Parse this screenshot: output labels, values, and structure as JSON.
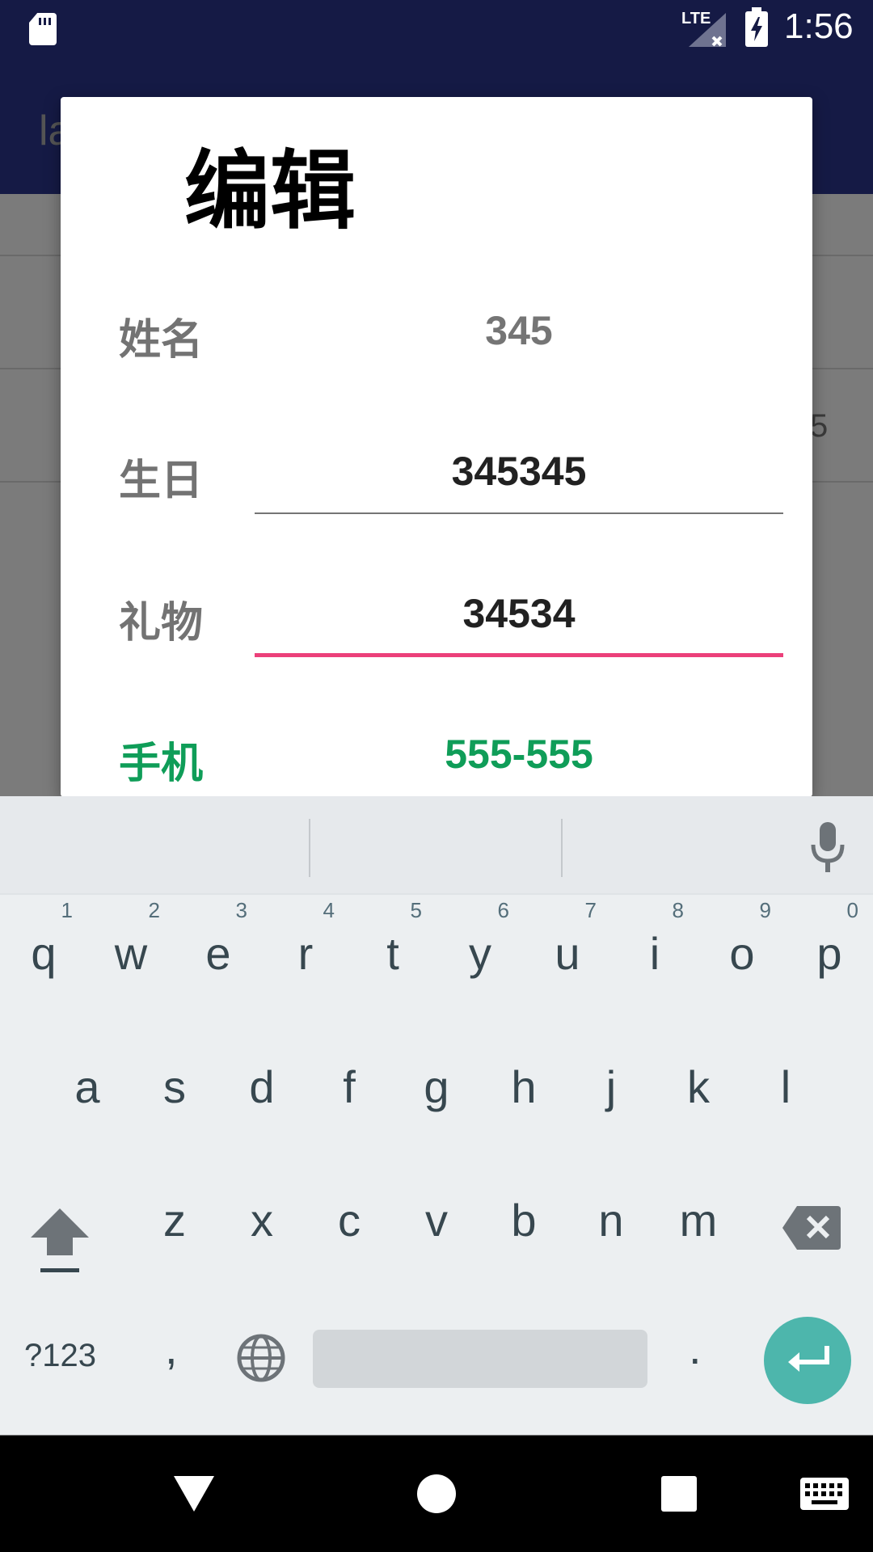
{
  "status_bar": {
    "network": "LTE",
    "time": "1:56"
  },
  "app_bar": {
    "title_partial": "la"
  },
  "background_list": {
    "row_value_partial": "5"
  },
  "dialog": {
    "title": "编辑",
    "fields": [
      {
        "label": "姓名",
        "value": "345",
        "editable": false
      },
      {
        "label": "生日",
        "value": "345345",
        "editable": true
      },
      {
        "label": "礼物",
        "value": "34534",
        "editable": true,
        "focused": true
      },
      {
        "label": "手机",
        "value": "555-555",
        "color": "#0f9d58"
      }
    ],
    "accent_color": "#ec407a"
  },
  "keyboard": {
    "row1": [
      {
        "key": "q",
        "num": "1"
      },
      {
        "key": "w",
        "num": "2"
      },
      {
        "key": "e",
        "num": "3"
      },
      {
        "key": "r",
        "num": "4"
      },
      {
        "key": "t",
        "num": "5"
      },
      {
        "key": "y",
        "num": "6"
      },
      {
        "key": "u",
        "num": "7"
      },
      {
        "key": "i",
        "num": "8"
      },
      {
        "key": "o",
        "num": "9"
      },
      {
        "key": "p",
        "num": "0"
      }
    ],
    "row2": [
      "a",
      "s",
      "d",
      "f",
      "g",
      "h",
      "j",
      "k",
      "l"
    ],
    "row3": [
      "z",
      "x",
      "c",
      "v",
      "b",
      "n",
      "m"
    ],
    "symbols_label": "?123",
    "comma": ",",
    "period": ".",
    "enter_color": "#4db6ac",
    "icons": [
      "mic-icon",
      "shift-icon",
      "backspace-icon",
      "globe-icon",
      "enter-icon"
    ]
  },
  "nav_bar": {
    "icons": [
      "back-icon",
      "home-icon",
      "recents-icon",
      "keyboard-icon"
    ]
  }
}
